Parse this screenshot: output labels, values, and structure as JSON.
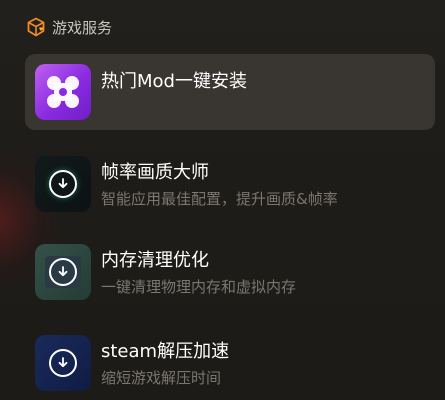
{
  "header": {
    "title": "游戏服务",
    "icon": "orange-cube-heart-icon",
    "accent": "#f08a24"
  },
  "items": [
    {
      "title": "热门Mod一键安装",
      "subtitle": "",
      "icon": "mod-purple-app-icon",
      "active": true
    },
    {
      "title": "帧率画质大师",
      "subtitle": "智能应用最佳配置，提升画质&帧率",
      "icon": "download-circle-icon"
    },
    {
      "title": "内存清理优化",
      "subtitle": "一键清理物理内存和虚拟内存",
      "icon": "download-circle-icon"
    },
    {
      "title": "steam解压加速",
      "subtitle": "缩短游戏解压时间",
      "icon": "download-circle-icon"
    }
  ]
}
